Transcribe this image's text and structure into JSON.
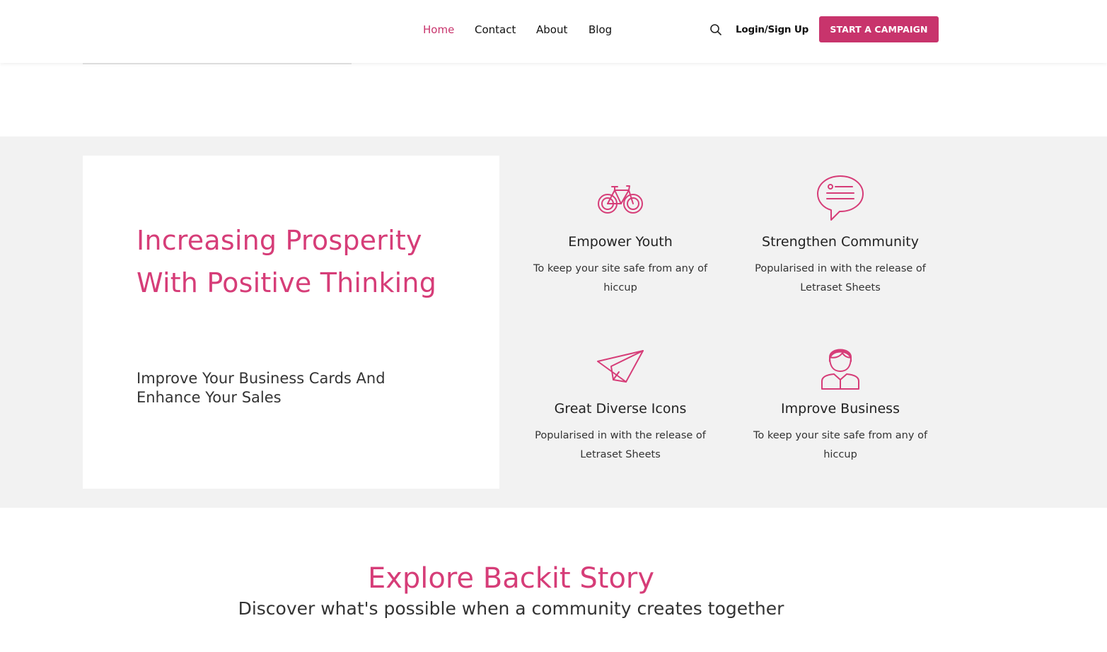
{
  "header": {
    "nav": [
      {
        "label": "Home",
        "active": true
      },
      {
        "label": "Contact",
        "active": false
      },
      {
        "label": "About",
        "active": false
      },
      {
        "label": "Blog",
        "active": false
      }
    ],
    "search_icon": "search-icon",
    "login_label": "Login/Sign Up",
    "cta_label": "START A CAMPAIGN"
  },
  "intro_card": {
    "title": "Increasing Prosperity With Positive Thinking",
    "subtitle": "Improve Your Business Cards And Enhance Your Sales"
  },
  "features": [
    {
      "icon": "bicycle-icon",
      "title": "Empower Youth",
      "description": "To keep your site safe from any of hiccup"
    },
    {
      "icon": "chat-bubble-icon",
      "title": "Strengthen Community",
      "description": "Popularised in with the release of Letraset Sheets"
    },
    {
      "icon": "paper-plane-icon",
      "title": "Great Diverse Icons",
      "description": "Popularised in with the release of Letraset Sheets"
    },
    {
      "icon": "person-icon",
      "title": "Improve Business",
      "description": "To keep your site safe from any of hiccup"
    }
  ],
  "story": {
    "title": "Explore Backit Story",
    "subtitle": "Discover what's possible when a community creates together"
  },
  "colors": {
    "accent": "#c8346c",
    "heading_pink": "#d63d78",
    "band_background": "#f2f2f2"
  }
}
